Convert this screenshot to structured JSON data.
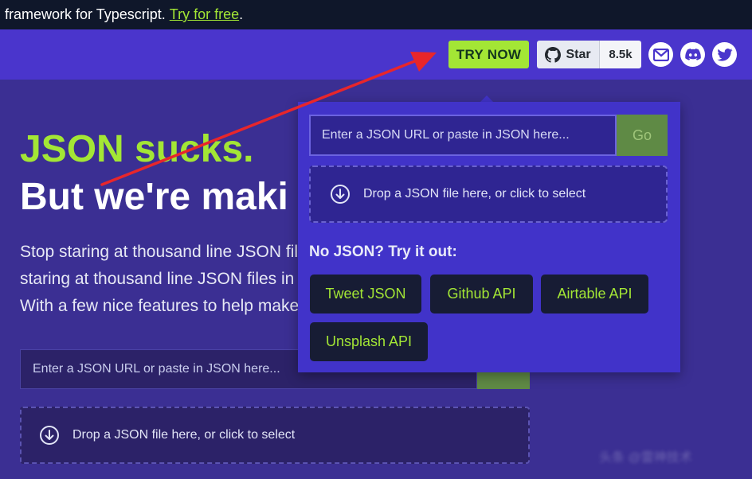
{
  "banner": {
    "text": "framework for Typescript.",
    "link": "Try for free",
    "trailing": "."
  },
  "nav": {
    "try_now": "TRY NOW",
    "github_star": "Star",
    "github_count": "8.5k",
    "icons": [
      "mail-icon",
      "discord-icon",
      "twitter-icon"
    ]
  },
  "hero": {
    "title_line1": "JSON sucks.",
    "title_line2": "But we're maki",
    "desc_lines": [
      "Stop staring at thousand line JSON fil",
      "staring at thousand line JSON files in",
      "With a few nice features to help make"
    ],
    "input_placeholder": "Enter a JSON URL or paste in JSON here...",
    "drop_label": "Drop a JSON file here, or click to select"
  },
  "dropdown": {
    "input_placeholder": "Enter a JSON URL or paste in JSON here...",
    "go_label": "Go",
    "drop_label": "Drop a JSON file here, or click to select",
    "samples_heading": "No JSON? Try it out:",
    "samples": [
      "Tweet JSON",
      "Github API",
      "Airtable API",
      "Unsplash API"
    ]
  },
  "watermark": "头条 @雷神技术",
  "colors": {
    "accent": "#a3e635",
    "navbar": "#4a35cc",
    "background": "#3b2f93",
    "dropdown": "#4133c9",
    "sample_button": "#171c34",
    "arrow": "#e8262b"
  }
}
